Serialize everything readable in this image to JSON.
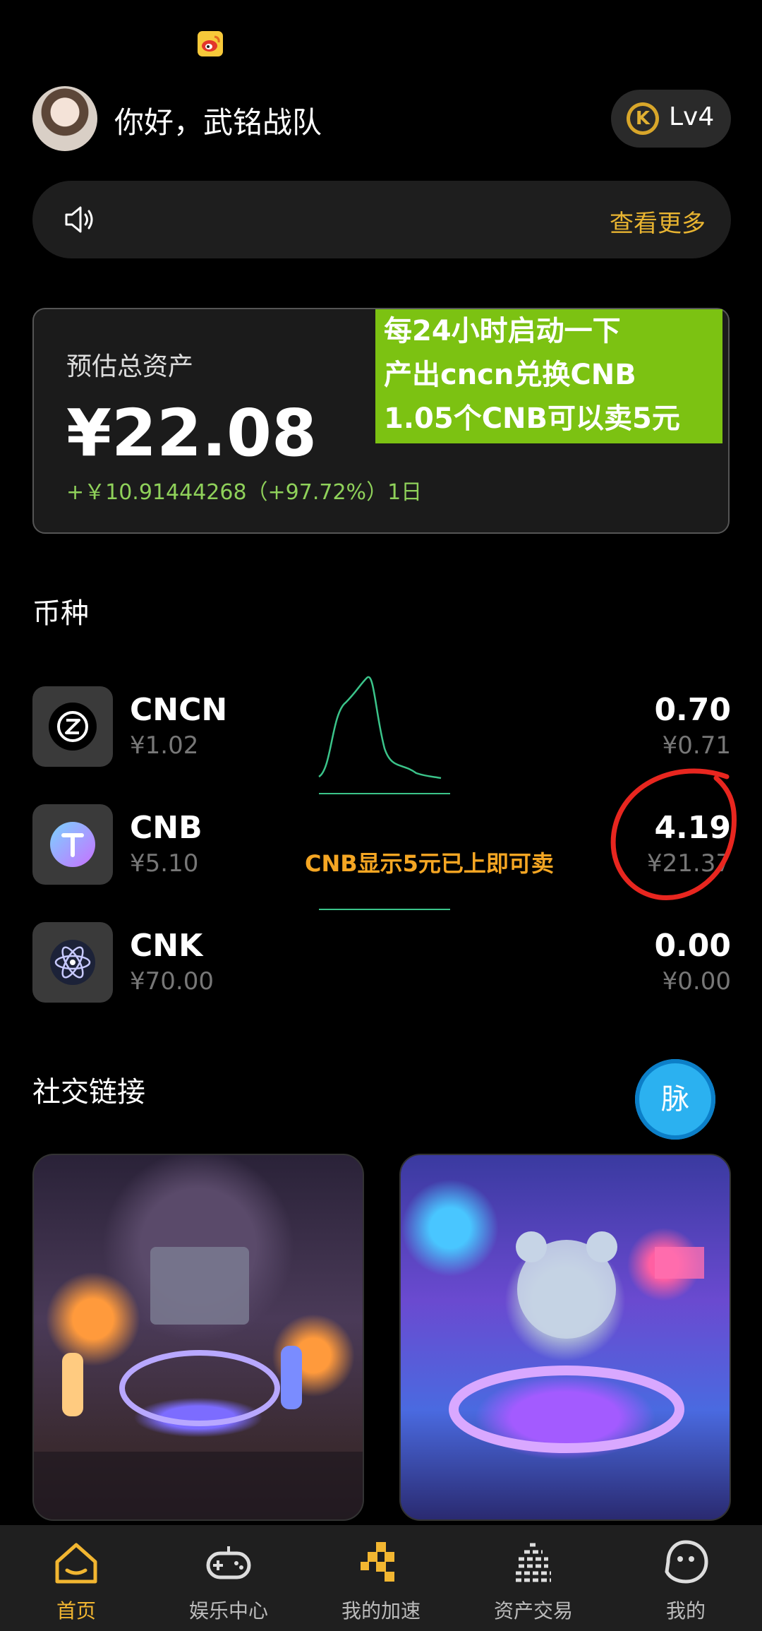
{
  "status_bar": {
    "app_icon": "weibo-icon"
  },
  "header": {
    "greeting": "你好，武铭战队",
    "level": "Lv4",
    "level_badge_letter": "K"
  },
  "notice": {
    "more_label": "查看更多"
  },
  "asset_card": {
    "label": "预估总资产",
    "value": "¥22.08",
    "change": "+￥10.91444268（+97.72%）1日"
  },
  "annotation_green": {
    "lines": [
      "每24小时启动一下",
      "产出cncn兑换CNB",
      "1.05个CNB可以卖5元"
    ]
  },
  "annotation_cnb": "CNB显示5元已上即可卖",
  "coins_section": {
    "title": "币种",
    "items": [
      {
        "name": "CNCN",
        "price": "¥1.02",
        "amount": "0.70",
        "value": "¥0.71",
        "icon": "z-coin-icon"
      },
      {
        "name": "CNB",
        "price": "¥5.10",
        "amount": "4.19",
        "value": "¥21.37",
        "icon": "t-coin-icon"
      },
      {
        "name": "CNK",
        "price": "¥70.00",
        "amount": "0.00",
        "value": "¥0.00",
        "icon": "atom-coin-icon"
      }
    ]
  },
  "social_section": {
    "title": "社交链接",
    "floating_button": "脉"
  },
  "bottom_nav": {
    "items": [
      {
        "label": "首页",
        "icon": "home-icon",
        "active": true
      },
      {
        "label": "娱乐中心",
        "icon": "gamepad-icon",
        "active": false
      },
      {
        "label": "我的加速",
        "icon": "blocks-icon",
        "active": false
      },
      {
        "label": "资产交易",
        "icon": "equalizer-icon",
        "active": false
      },
      {
        "label": "我的",
        "icon": "face-icon",
        "active": false
      }
    ]
  },
  "colors": {
    "background": "#000000",
    "accent": "#f2b631",
    "positive": "#8fd15a",
    "note_green": "#7cc212",
    "note_orange": "#f5a623",
    "annotation_red": "#e8261f"
  }
}
